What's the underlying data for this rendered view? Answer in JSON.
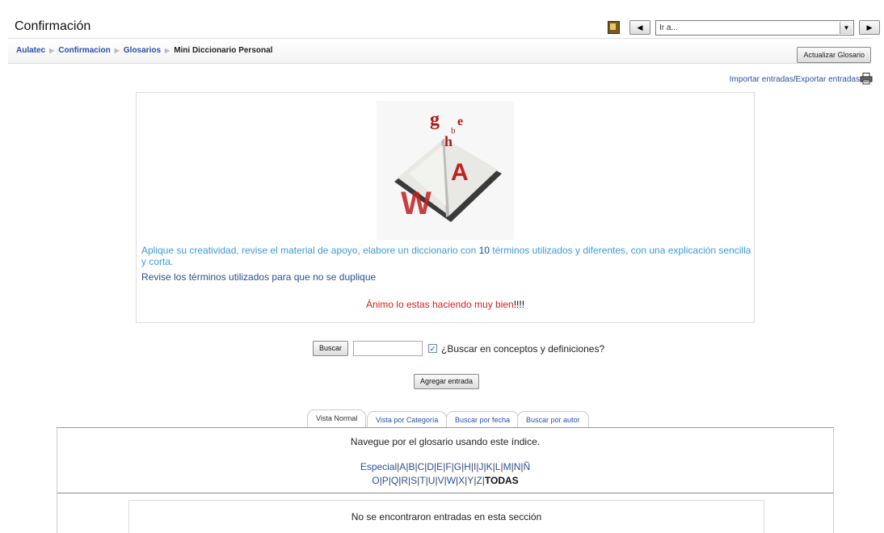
{
  "header": {
    "title": "Confirmación",
    "jump_placeholder": "Ir a..."
  },
  "navbar": {
    "breadcrumb": [
      "Aulatec",
      "Confirmacion",
      "Glosarios"
    ],
    "current": "Mini Diccionario Personal",
    "update_button": "Actualizar Glosario"
  },
  "actions": {
    "import": "Importar entradas",
    "separator": "/",
    "export": "Exportar entradas"
  },
  "intro": {
    "line1_a": "Aplique su creatividad, revise el material de apoyo, elabore un diccionario con ",
    "line1_num": "10",
    "line1_b": " términos utilizados y diferentes, con una explicación sencilla y corta.",
    "line2": "Revise los términos utilizados para que no se duplique",
    "line3": "Ánimo lo estas haciendo muy bien",
    "line3_em": "!!!!"
  },
  "search": {
    "button": "Buscar",
    "value": "",
    "checkbox_label": "¿Buscar en conceptos y definiciones?",
    "checked": true
  },
  "add_entry": "Agregar entrada",
  "tabs": [
    "Vista Normal",
    "Vista por Categoría",
    "Buscar por fecha",
    "Buscar por autor"
  ],
  "browse_note": "Navegue por el glosario usando este índice.",
  "alphabet_row1": [
    "Especial",
    "A",
    "B",
    "C",
    "D",
    "E",
    "F",
    "G",
    "H",
    "I",
    "J",
    "K",
    "L",
    "M",
    "N",
    "Ñ"
  ],
  "alphabet_row2": [
    "O",
    "P",
    "Q",
    "R",
    "S",
    "T",
    "U",
    "V",
    "W",
    "X",
    "Y",
    "Z"
  ],
  "alphabet_all": "TODAS",
  "empty_message": "No se encontraron entradas en esta sección",
  "colors": {
    "link": "#2a4fa8",
    "intro_light": "#3d9bd8",
    "alert": "#d62020"
  }
}
